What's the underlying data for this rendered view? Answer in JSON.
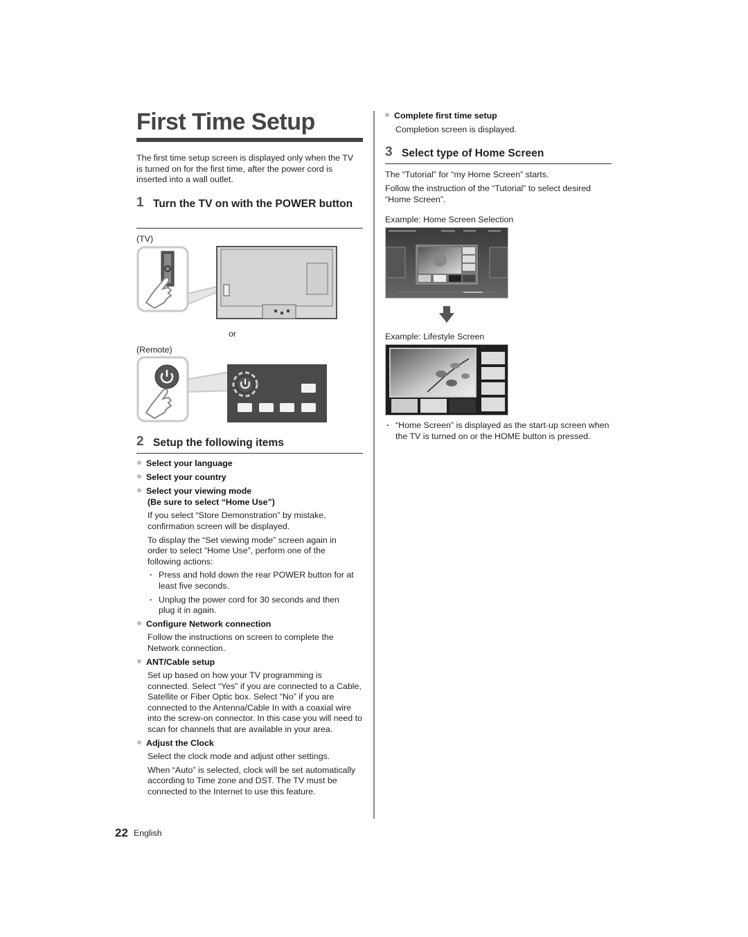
{
  "page": {
    "title": "First Time Setup",
    "intro": "The first time setup screen is displayed only when the TV is turned on for the first time, after the power cord is inserted into a wall outlet.",
    "footer": {
      "page_number": "22",
      "language": "English"
    }
  },
  "step1": {
    "number": "1",
    "heading": "Turn the TV on with the POWER button",
    "tv_label": "(TV)",
    "or_label": "or",
    "remote_label": "(Remote)",
    "icons": [
      "hand-pointer-icon",
      "power-icon"
    ]
  },
  "step2": {
    "number": "2",
    "heading": "Setup the following items",
    "items": [
      {
        "label": "Select your language"
      },
      {
        "label": "Select your country"
      },
      {
        "label": "Select your viewing mode",
        "label2": "(Be sure to select “Home Use”)",
        "text1": "If you select “Store Demonstration” by mistake, confirmation screen will be displayed.",
        "text2": "To display the “Set viewing mode” screen again in order to select “Home Use”, perform one of the following actions:",
        "sub_bullets": [
          "Press and hold down the rear POWER button for at least five seconds.",
          "Unplug the power cord for 30 seconds and then plug it in again."
        ]
      },
      {
        "label": "Configure Network connection",
        "text1": "Follow the instructions on screen to complete the Network connection."
      },
      {
        "label": "ANT/Cable setup",
        "text1": "Set up based on how your TV programming is connected. Select “Yes” if you are connected to a Cable, Satellite or Fiber Optic box. Select “No” if you are connected to the Antenna/Cable In with a coaxial wire into the screw-on connector. In this case you will need to scan for channels that are available in your area."
      },
      {
        "label": "Adjust the Clock",
        "text1": "Select the clock mode and adjust other settings.",
        "text2": "When “Auto” is selected, clock will be set automatically according to Time zone and DST. The TV must be connected to the Internet to use this feature."
      },
      {
        "label": "Complete first time setup",
        "text1": "Completion screen is displayed."
      }
    ]
  },
  "step3": {
    "number": "3",
    "heading": "Select type of Home Screen",
    "text1": "The “Tutorial” for “my Home Screen” starts.",
    "text2": "Follow the instruction of the “Tutorial” to select desired “Home Screen”.",
    "example1_caption": "Example: Home Screen Selection",
    "example2_caption": "Example: Lifestyle Screen",
    "note": "“Home Screen” is displayed as the start-up screen when the TV is turned on or the HOME button is pressed.",
    "arrow_icon": "arrow-down-icon"
  }
}
